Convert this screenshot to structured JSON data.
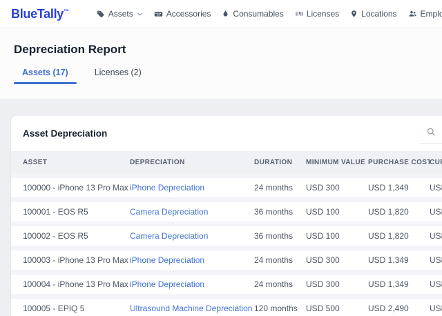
{
  "brand": {
    "name": "BlueTally",
    "trademark": "™",
    "color": "#2840d8"
  },
  "nav": {
    "items": [
      {
        "label": "Assets",
        "icon": "tag-icon",
        "has_dropdown": true
      },
      {
        "label": "Accessories",
        "icon": "keyboard-icon"
      },
      {
        "label": "Consumables",
        "icon": "droplet-icon"
      },
      {
        "label": "Licenses",
        "icon": "barcode-icon"
      },
      {
        "label": "Locations",
        "icon": "map-pin-icon"
      },
      {
        "label": "Employees",
        "icon": "users-icon"
      }
    ]
  },
  "page": {
    "title": "Depreciation Report"
  },
  "tabs": [
    {
      "label": "Assets (17)",
      "active": true
    },
    {
      "label": "Licenses (2)",
      "active": false
    }
  ],
  "card": {
    "title": "Asset Depreciation"
  },
  "table": {
    "columns": [
      "ASSET",
      "DEPRECIATION",
      "DURATION",
      "MINIMUM VALUE",
      "PURCHASE COST",
      "CURRENT VALUE"
    ],
    "rows": [
      {
        "asset": "100000 - iPhone 13 Pro Max",
        "depreciation": "iPhone Depreciation",
        "duration": "24 months",
        "minimum_value": "USD 300",
        "purchase_cost": "USD 1,349",
        "current_value": "USD"
      },
      {
        "asset": "100001 - EOS R5",
        "depreciation": "Camera Depreciation",
        "duration": "36 months",
        "minimum_value": "USD 100",
        "purchase_cost": "USD 1,820",
        "current_value": "USD"
      },
      {
        "asset": "100002 - EOS R5",
        "depreciation": "Camera Depreciation",
        "duration": "36 months",
        "minimum_value": "USD 100",
        "purchase_cost": "USD 1,820",
        "current_value": "USD"
      },
      {
        "asset": "100003 - iPhone 13 Pro Max",
        "depreciation": "iPhone Depreciation",
        "duration": "24 months",
        "minimum_value": "USD 300",
        "purchase_cost": "USD 1,349",
        "current_value": "USD"
      },
      {
        "asset": "100004 - iPhone 13 Pro Max",
        "depreciation": "iPhone Depreciation",
        "duration": "24 months",
        "minimum_value": "USD 300",
        "purchase_cost": "USD 1,349",
        "current_value": "USD"
      },
      {
        "asset": "100005 - EPIQ 5",
        "depreciation": "Ultrasound Machine Depreciation",
        "duration": "120 months",
        "minimum_value": "USD 500",
        "purchase_cost": "USD 2,490",
        "current_value": "USD"
      }
    ]
  },
  "colors": {
    "brand_blue": "#2840d8",
    "link_blue": "#3e73d6",
    "tab_active_blue": "#3e6fd0",
    "page_background": "#edeff3",
    "table_header_background": "#eef1f5"
  }
}
